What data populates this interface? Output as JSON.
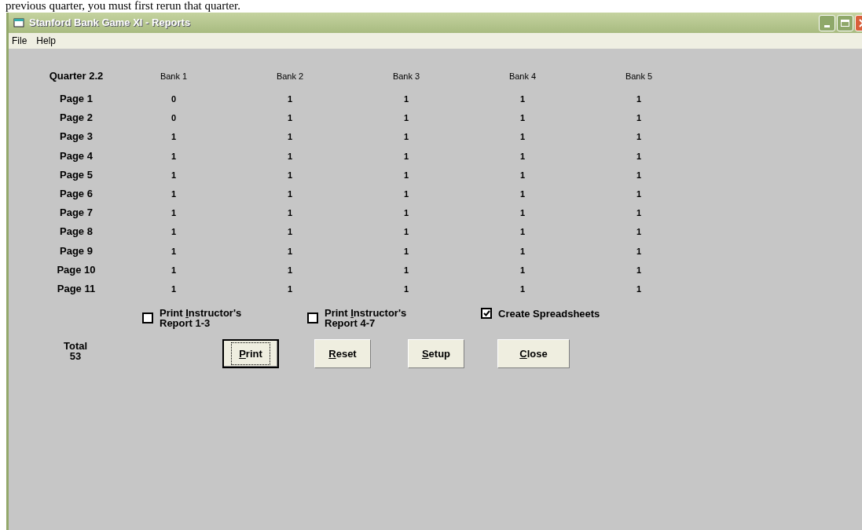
{
  "document_text": "previous quarter, you must first rerun that quarter.",
  "window": {
    "title": "Stanford Bank Game XI - Reports"
  },
  "menu": [
    {
      "label": "File"
    },
    {
      "label": "Help"
    }
  ],
  "table": {
    "corner": "Quarter 2.2",
    "columns": [
      "Bank 1",
      "Bank 2",
      "Bank 3",
      "Bank 4",
      "Bank 5"
    ],
    "rows": [
      {
        "label": "Page 1",
        "cells": [
          "0",
          "1",
          "1",
          "1",
          "1"
        ]
      },
      {
        "label": "Page 2",
        "cells": [
          "0",
          "1",
          "1",
          "1",
          "1"
        ]
      },
      {
        "label": "Page 3",
        "cells": [
          "1",
          "1",
          "1",
          "1",
          "1"
        ]
      },
      {
        "label": "Page 4",
        "cells": [
          "1",
          "1",
          "1",
          "1",
          "1"
        ]
      },
      {
        "label": "Page 5",
        "cells": [
          "1",
          "1",
          "1",
          "1",
          "1"
        ]
      },
      {
        "label": "Page 6",
        "cells": [
          "1",
          "1",
          "1",
          "1",
          "1"
        ]
      },
      {
        "label": "Page 7",
        "cells": [
          "1",
          "1",
          "1",
          "1",
          "1"
        ]
      },
      {
        "label": "Page 8",
        "cells": [
          "1",
          "1",
          "1",
          "1",
          "1"
        ]
      },
      {
        "label": "Page 9",
        "cells": [
          "1",
          "1",
          "1",
          "1",
          "1"
        ]
      },
      {
        "label": "Page 10",
        "cells": [
          "1",
          "1",
          "1",
          "1",
          "1"
        ]
      },
      {
        "label": "Page 11",
        "cells": [
          "1",
          "1",
          "1",
          "1",
          "1"
        ]
      }
    ]
  },
  "checkboxes": [
    {
      "before": "Print ",
      "key": "I",
      "after": "nstructor's",
      "line2": "Report 1-3",
      "checked": false
    },
    {
      "before": "Print ",
      "key": "I",
      "after": "nstructor's",
      "line2": "Report 4-7",
      "checked": false
    },
    {
      "after": "Create Spreadsheets",
      "checked": true
    }
  ],
  "total": {
    "label": "Total",
    "value": "53"
  },
  "buttons": [
    {
      "key": "P",
      "after": "rint",
      "focused": true
    },
    {
      "key": "R",
      "after": "eset",
      "focused": false
    },
    {
      "key": "S",
      "after": "etup",
      "focused": false
    },
    {
      "key": "C",
      "after": "lose",
      "focused": false
    }
  ]
}
